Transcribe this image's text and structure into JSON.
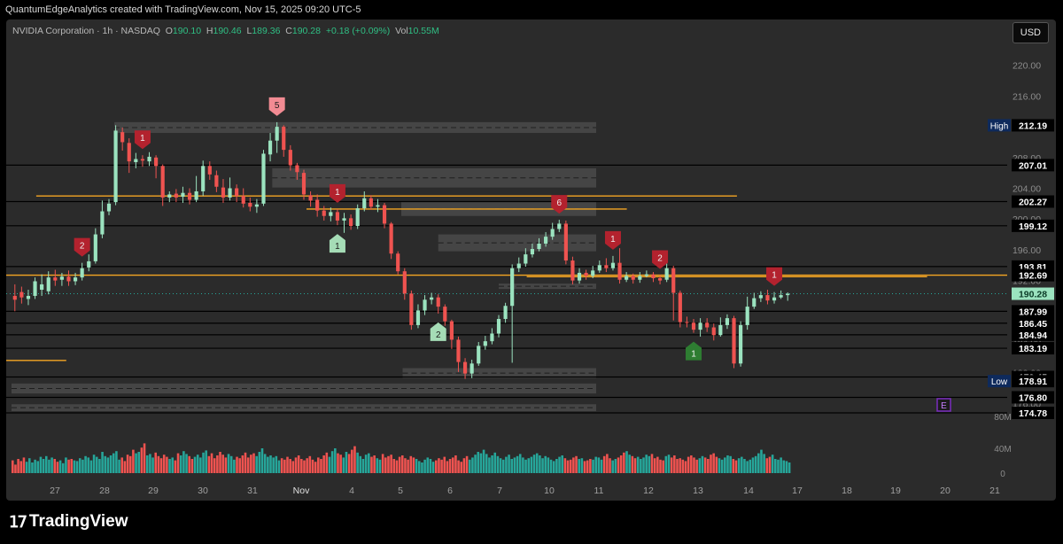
{
  "credit": "QuantumEdgeAnalytics created with TradingView.com, Nov 15, 2025 09:20 UTC-5",
  "brand": "TradingView",
  "currency_button": "USD",
  "legend": {
    "symbol": "NVIDIA Corporation · 1h · NASDAQ",
    "open_label": "O",
    "open": "190.10",
    "high_label": "H",
    "high": "190.46",
    "low_label": "L",
    "low": "189.36",
    "close_label": "C",
    "close": "190.28",
    "change": "+0.18 (+0.09%)",
    "vol_label": "Vol",
    "vol": "10.55M"
  },
  "colors": {
    "up": "#26a69a",
    "down": "#ef5350",
    "up_light": "#9be3bf",
    "level_line": "#000000",
    "orange": "#f5a623",
    "zone": "#4a4a4a",
    "badge_red": "#b3222e",
    "badge_green": "#2e7d32",
    "badge_pink": "#f28b93",
    "badge_mint": "#a5dcb6",
    "earnings": "#7b2cbf"
  },
  "chart_data": {
    "type": "candlestick",
    "symbol": "NVDA",
    "interval": "1h",
    "x_axis_labels": [
      "27",
      "28",
      "29",
      "30",
      "31",
      "Nov",
      "4",
      "5",
      "6",
      "7",
      "10",
      "11",
      "12",
      "13",
      "14",
      "17",
      "18",
      "19",
      "20",
      "21"
    ],
    "price_ticks": [
      220,
      216,
      212,
      208,
      204,
      200,
      196,
      192,
      188,
      184,
      180,
      176
    ],
    "ylim": [
      174.78,
      222.5
    ],
    "volume_ticks": [
      "80M",
      "40M",
      "0"
    ],
    "price_labels": [
      {
        "value": 212.19,
        "text": "212.19",
        "tag": "High"
      },
      {
        "value": 207.01,
        "text": "207.01"
      },
      {
        "value": 202.27,
        "text": "202.27"
      },
      {
        "value": 199.12,
        "text": "199.12"
      },
      {
        "value": 193.81,
        "text": "193.81"
      },
      {
        "value": 192.69,
        "text": "192.69"
      },
      {
        "value": 190.28,
        "text": "190.28",
        "current": true
      },
      {
        "value": 187.99,
        "text": "187.99"
      },
      {
        "value": 186.45,
        "text": "186.45"
      },
      {
        "value": 184.94,
        "text": "184.94"
      },
      {
        "value": 183.19,
        "text": "183.19"
      },
      {
        "value": 179.45,
        "text": "179.45"
      },
      {
        "value": 178.91,
        "text": "178.91",
        "tag": "Low"
      },
      {
        "value": 176.8,
        "text": "176.80"
      },
      {
        "value": 174.78,
        "text": "174.78"
      }
    ],
    "horizontal_levels": [
      207.01,
      202.27,
      199.12,
      193.81,
      187.99,
      186.45,
      184.94,
      183.19,
      179.45,
      176.8,
      174.78
    ],
    "orange_levels": [
      {
        "value": 203.0,
        "from": 0.03,
        "to": 0.73
      },
      {
        "value": 201.3,
        "from": 0.3,
        "to": 0.62
      },
      {
        "value": 192.7,
        "from": 0.0,
        "to": 1.0
      },
      {
        "value": 192.5,
        "from": 0.52,
        "to": 0.92
      },
      {
        "value": 181.6,
        "from": 0.0,
        "to": 0.06
      }
    ],
    "zones": [
      {
        "top": 212.6,
        "bottom": 211.2,
        "start": 15.3,
        "end": 86.5
      },
      {
        "top": 206.6,
        "bottom": 204.1,
        "start": 38.8,
        "end": 86.5
      },
      {
        "top": 198.0,
        "bottom": 195.8,
        "start": 63.5,
        "end": 86.5
      },
      {
        "top": 202.2,
        "bottom": 200.4,
        "start": 58.0,
        "end": 86.5
      },
      {
        "top": 191.6,
        "bottom": 190.9,
        "start": 72.5,
        "end": 86.5
      },
      {
        "top": 180.6,
        "bottom": 179.3,
        "start": 58.2,
        "end": 86.5
      },
      {
        "top": 178.6,
        "bottom": 177.3,
        "start": 0.0,
        "end": 86.5
      },
      {
        "top": 175.9,
        "bottom": 175.0,
        "start": 0.0,
        "end": 86.5
      }
    ],
    "candles": [
      [
        190,
        189.5,
        191.5,
        188
      ],
      [
        190.5,
        189.8,
        191.2,
        189
      ],
      [
        189.6,
        190,
        190.8,
        188.8
      ],
      [
        190,
        191.9,
        192.4,
        189.6
      ],
      [
        190.8,
        191.5,
        192.8,
        190
      ],
      [
        190.6,
        192.4,
        193.2,
        190.2
      ],
      [
        192.4,
        192,
        193.4,
        191.3
      ],
      [
        192.1,
        192.5,
        193,
        191.3
      ],
      [
        192.5,
        191.9,
        193.3,
        191.3
      ],
      [
        191.9,
        192.4,
        193,
        191.4
      ],
      [
        192.4,
        193.6,
        194.3,
        192
      ],
      [
        193.7,
        194.5,
        195.4,
        193.2
      ],
      [
        194.5,
        198,
        198.8,
        194.2
      ],
      [
        198,
        201,
        202.4,
        197.5
      ],
      [
        201,
        202,
        202.6,
        200.5
      ],
      [
        202.2,
        211.5,
        212.2,
        201.8
      ],
      [
        211.3,
        210,
        211.9,
        208.9
      ],
      [
        209.9,
        207.5,
        210.5,
        206
      ],
      [
        207.4,
        207.8,
        208.6,
        206.6
      ],
      [
        207.8,
        207.6,
        208.3,
        206.8
      ],
      [
        207.5,
        208.1,
        208.7,
        206.9
      ],
      [
        208,
        206.9,
        208.3,
        205.3
      ],
      [
        206.9,
        202.8,
        207.1,
        201.7
      ],
      [
        202.8,
        203.2,
        203.6,
        202.2
      ],
      [
        203.3,
        202.8,
        203.9,
        202.2
      ],
      [
        202.9,
        203.4,
        204.2,
        202.1
      ],
      [
        203.4,
        202.5,
        204,
        201.9
      ],
      [
        202.5,
        203.6,
        205.6,
        202.2
      ],
      [
        203.6,
        206.9,
        207.6,
        203
      ],
      [
        206.9,
        205.8,
        207.5,
        205.1
      ],
      [
        205.7,
        204.2,
        206.3,
        203.5
      ],
      [
        204.1,
        202.8,
        205.2,
        202.1
      ],
      [
        202.8,
        204,
        205.4,
        202.4
      ],
      [
        204,
        203,
        204.5,
        202.2
      ],
      [
        203,
        202,
        204,
        201.5
      ],
      [
        202.1,
        201.6,
        202.8,
        201
      ],
      [
        201.6,
        201.9,
        202.6,
        200.8
      ],
      [
        202,
        208.5,
        209,
        201.7
      ],
      [
        208.4,
        210.2,
        211.2,
        207.5
      ],
      [
        210.2,
        212,
        212.6,
        208.6
      ],
      [
        212,
        209,
        212.2,
        208.1
      ],
      [
        209,
        207,
        209.6,
        206.3
      ],
      [
        207,
        206.1,
        207.3,
        205.1
      ],
      [
        206,
        203.2,
        206.4,
        202.5
      ],
      [
        203.1,
        202.4,
        203.6,
        201.6
      ],
      [
        202.5,
        201.1,
        203.2,
        200.3
      ],
      [
        201.1,
        200.4,
        201.7,
        199.8
      ],
      [
        200.4,
        200.9,
        201.5,
        199.7
      ],
      [
        200.9,
        199.8,
        201.3,
        199.2
      ],
      [
        199.8,
        200.1,
        200.8,
        198.2
      ],
      [
        200.1,
        199.1,
        200.6,
        198.6
      ],
      [
        199.1,
        201.4,
        201.9,
        198.7
      ],
      [
        201.4,
        202.7,
        203.6,
        201
      ],
      [
        202.7,
        201.6,
        203.1,
        201.2
      ],
      [
        201.6,
        201.8,
        202.6,
        200.9
      ],
      [
        201.8,
        199.4,
        202.1,
        198.8
      ],
      [
        199.4,
        195.5,
        199.6,
        194.8
      ],
      [
        195.5,
        193.2,
        195.8,
        192.8
      ],
      [
        193.2,
        190.3,
        193.6,
        189.5
      ],
      [
        190.3,
        186.2,
        190.7,
        185.6
      ],
      [
        186.2,
        188.1,
        188.9,
        185.8
      ],
      [
        188.1,
        189.5,
        190.1,
        187.5
      ],
      [
        189.5,
        189.8,
        190.4,
        188.9
      ],
      [
        189.8,
        188.6,
        190.2,
        187.7
      ],
      [
        188.6,
        186.7,
        188.9,
        186.1
      ],
      [
        186.7,
        184.3,
        186.9,
        183.1
      ],
      [
        184.3,
        181.4,
        184.7,
        180.1
      ],
      [
        181.4,
        179.9,
        181.9,
        179.2
      ],
      [
        179.9,
        181.2,
        181.7,
        179.3
      ],
      [
        181.2,
        183.5,
        184,
        180.9
      ],
      [
        183.5,
        184.1,
        184.8,
        183
      ],
      [
        184.1,
        185.1,
        185.8,
        183.7
      ],
      [
        185.1,
        187,
        187.5,
        184.6
      ],
      [
        187,
        188.7,
        189.1,
        186.5
      ],
      [
        188.7,
        193.6,
        194.1,
        181.3
      ],
      [
        193.6,
        194.2,
        195,
        193.1
      ],
      [
        194.2,
        195.4,
        196.2,
        193.8
      ],
      [
        195.4,
        196.1,
        196.8,
        195
      ],
      [
        196.1,
        196.8,
        197.5,
        195.8
      ],
      [
        196.8,
        197.7,
        198.3,
        196.4
      ],
      [
        197.7,
        198.7,
        199.5,
        197.3
      ],
      [
        198.7,
        199.4,
        199.9,
        198.3
      ],
      [
        199.4,
        194.6,
        199.8,
        194.1
      ],
      [
        194.6,
        192,
        195.1,
        191.5
      ],
      [
        192,
        193,
        193.6,
        191.6
      ],
      [
        193,
        192.6,
        193.4,
        192.1
      ],
      [
        192.6,
        193.3,
        193.9,
        192.3
      ],
      [
        193.3,
        194,
        194.6,
        193
      ],
      [
        194,
        193.6,
        194.9,
        193.1
      ],
      [
        193.6,
        194.3,
        195.2,
        193.3
      ],
      [
        194.3,
        192.1,
        196.2,
        191.6
      ],
      [
        192.1,
        192.6,
        193.1,
        191.8
      ],
      [
        192.6,
        192.1,
        192.9,
        191.6
      ],
      [
        192.1,
        192.6,
        193.1,
        191.7
      ],
      [
        192.6,
        192.8,
        193.3,
        192.4
      ],
      [
        192.8,
        192.3,
        193.1,
        191.8
      ],
      [
        192.3,
        192,
        192.7,
        191.5
      ],
      [
        192.1,
        193.6,
        194.2,
        191.8
      ],
      [
        193.6,
        190.4,
        193.9,
        186.8
      ],
      [
        190.4,
        186.6,
        190.7,
        185.9
      ],
      [
        186.6,
        186.5,
        187.3,
        185.9
      ],
      [
        186.5,
        185.6,
        187,
        185.2
      ],
      [
        185.6,
        186.5,
        187.1,
        184.7
      ],
      [
        186.5,
        185.9,
        187.1,
        185.3
      ],
      [
        185.9,
        184.9,
        186.4,
        184.2
      ],
      [
        184.9,
        186.2,
        187.2,
        184.7
      ],
      [
        186.2,
        187.1,
        187.6,
        185.7
      ],
      [
        187.1,
        181.2,
        187.4,
        180.6
      ],
      [
        181.2,
        186.2,
        186.7,
        180.8
      ],
      [
        186.2,
        188.6,
        189.9,
        185.6
      ],
      [
        188.6,
        189.7,
        190.4,
        188.3
      ],
      [
        189.7,
        190.1,
        190.6,
        189.2
      ],
      [
        190.1,
        189.4,
        190.8,
        188.9
      ],
      [
        189.4,
        189.8,
        190.5,
        189
      ],
      [
        189.8,
        190.1,
        190.7,
        189.6
      ],
      [
        190.1,
        190.28,
        190.46,
        189.36
      ]
    ],
    "volume": [
      18,
      12,
      20,
      17,
      22,
      16,
      21,
      15,
      19,
      17,
      23,
      20,
      24,
      19,
      22,
      20,
      16,
      18,
      14,
      22,
      19,
      20,
      18,
      17,
      21,
      19,
      24,
      22,
      18,
      26,
      23,
      20,
      30,
      24,
      22,
      25,
      28,
      31,
      19,
      22,
      17,
      26,
      24,
      33,
      28,
      30,
      36,
      42,
      25,
      27,
      22,
      29,
      24,
      21,
      26,
      23,
      20,
      22,
      18,
      28,
      25,
      31,
      27,
      24,
      20,
      23,
      26,
      22,
      29,
      32,
      24,
      28,
      21,
      25,
      30,
      26,
      22,
      27,
      24,
      19,
      23,
      21,
      25,
      29,
      22,
      26,
      28,
      24,
      30,
      35,
      27,
      23,
      25,
      22,
      24,
      18,
      21,
      19,
      23,
      20,
      17,
      22,
      25,
      20,
      18,
      21,
      24,
      19,
      16,
      22,
      20,
      25,
      29,
      23,
      31,
      35,
      28,
      26,
      22,
      30,
      27,
      33,
      38,
      29,
      24,
      20,
      26,
      28,
      23,
      25,
      21,
      19,
      27,
      22,
      24,
      26,
      20,
      18,
      23,
      25,
      21,
      19,
      24,
      22,
      20,
      17,
      15,
      19,
      22,
      20,
      16,
      18,
      21,
      19,
      23,
      17,
      20,
      22,
      25,
      18,
      16,
      21,
      24,
      19,
      22,
      26,
      30,
      28,
      33,
      27,
      22,
      25,
      29,
      24,
      21,
      19,
      23,
      26,
      20,
      22,
      24,
      27,
      22,
      19,
      21,
      23,
      26,
      28,
      25,
      21,
      24,
      22,
      19,
      17,
      20,
      23,
      25,
      21,
      18,
      19,
      22,
      24,
      20,
      21,
      17,
      18,
      20,
      19,
      23,
      22,
      19,
      24,
      27,
      21,
      18,
      20,
      22,
      25,
      29,
      31,
      26,
      24,
      21,
      23,
      20,
      22,
      26,
      24,
      27,
      21,
      23,
      19,
      18,
      24,
      26,
      22,
      25,
      20,
      21,
      19,
      17,
      23,
      25,
      22,
      19,
      21,
      24,
      22,
      20,
      26,
      28,
      23,
      21,
      19,
      22,
      25,
      24,
      20,
      18,
      21,
      23,
      20,
      17,
      19,
      22,
      24,
      28,
      33,
      27,
      21,
      23,
      26,
      20,
      19,
      22,
      18,
      17,
      15
    ],
    "sequence_badges": [
      {
        "label": "5",
        "candle": 39,
        "side": "above",
        "style": "pink"
      },
      {
        "label": "1",
        "candle": 19,
        "side": "above",
        "style": "red"
      },
      {
        "label": "2",
        "candle": 10,
        "side": "above",
        "style": "red"
      },
      {
        "label": "1",
        "candle": 48,
        "side": "above",
        "style": "red"
      },
      {
        "label": "6",
        "candle": 81,
        "side": "above",
        "style": "red"
      },
      {
        "label": "1",
        "candle": 89,
        "side": "above",
        "style": "red"
      },
      {
        "label": "2",
        "candle": 96,
        "side": "above",
        "style": "red"
      },
      {
        "label": "1",
        "candle": 113,
        "side": "above",
        "style": "red"
      },
      {
        "label": "1",
        "candle": 48,
        "side": "below",
        "style": "mint"
      },
      {
        "label": "2",
        "candle": 63,
        "side": "below",
        "style": "mint"
      },
      {
        "label": "1",
        "candle": 101,
        "side": "below",
        "style": "green"
      }
    ],
    "earnings_marker": "E"
  }
}
